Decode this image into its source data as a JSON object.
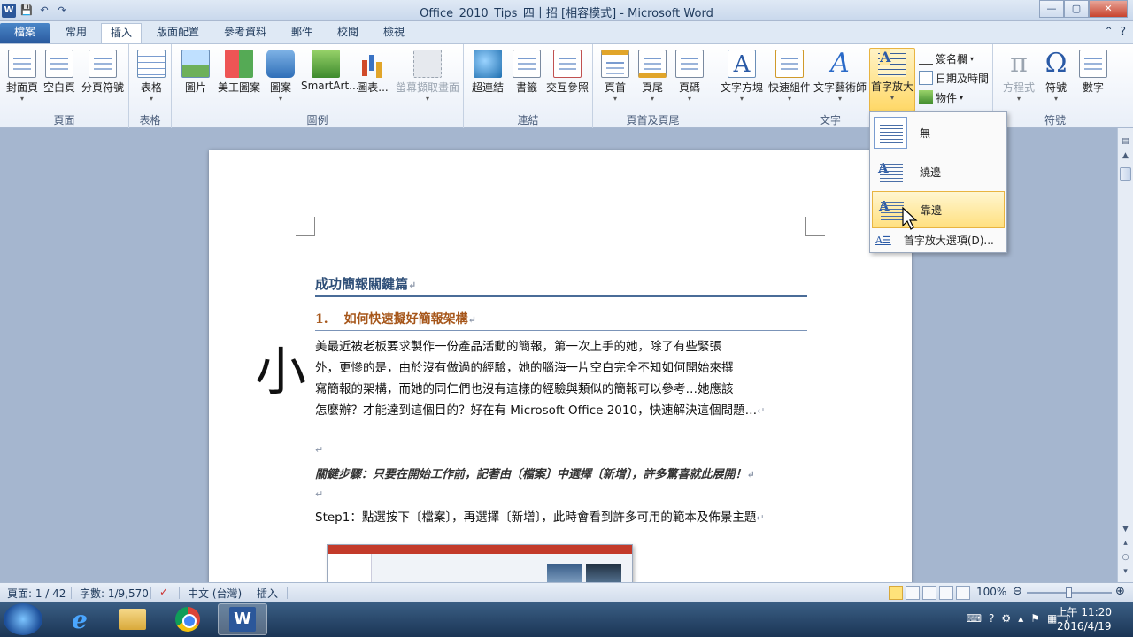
{
  "window": {
    "title": "Office_2010_Tips_四十招 [相容模式] - Microsoft Word",
    "qat": {
      "word_logo": "W",
      "save": "💾",
      "undo": "↶",
      "redo": "↷"
    },
    "buttons": {
      "minimize": "—",
      "maximize": "▢",
      "close": "✕"
    }
  },
  "tabs": {
    "file": "檔案",
    "items": [
      "常用",
      "插入",
      "版面配置",
      "參考資料",
      "郵件",
      "校閱",
      "檢視"
    ],
    "active": "插入",
    "help_icons": {
      "collapse": "⌃",
      "help": "?"
    }
  },
  "ribbon": {
    "groups": {
      "pages": {
        "label": "頁面",
        "buttons": [
          "封面頁",
          "空白頁",
          "分頁符號"
        ]
      },
      "tables": {
        "label": "表格",
        "buttons": [
          "表格"
        ]
      },
      "illustrations": {
        "label": "圖例",
        "buttons": [
          "圖片",
          "美工圖案",
          "圖案",
          "SmartArt...",
          "圖表...",
          "螢幕擷取畫面"
        ]
      },
      "links": {
        "label": "連結",
        "buttons": [
          "超連結",
          "書籤",
          "交互參照"
        ]
      },
      "header_footer": {
        "label": "頁首及頁尾",
        "buttons": [
          "頁首",
          "頁尾",
          "頁碼"
        ]
      },
      "text": {
        "label": "文字",
        "buttons": [
          "文字方塊",
          "快速組件",
          "文字藝術師",
          "首字放大"
        ],
        "small": [
          "簽名欄",
          "日期及時間",
          "物件"
        ]
      },
      "symbols": {
        "label": "符號",
        "buttons": [
          "方程式",
          "符號",
          "數字"
        ]
      }
    }
  },
  "dropcap_menu": {
    "items": [
      {
        "label": "無",
        "letter": ""
      },
      {
        "label": "繞邊",
        "letter": "A"
      },
      {
        "label": "靠邊",
        "letter": "A"
      }
    ],
    "options_label": "首字放大選項(D)..."
  },
  "document": {
    "heading1": "成功簡報關鍵篇",
    "heading2_num": "1.",
    "heading2": "如何快速擬好簡報架構",
    "dropcap": "小",
    "para_lines": [
      "美最近被老板要求製作一份產品活動的簡報，第一次上手的她，除了有些緊張",
      "外，更慘的是，由於沒有做過的經驗，她的腦海一片空白完全不知如何開始來撰",
      "寫簡報的架構，而她的同仁們也沒有這樣的經驗與類似的簡報可以參考…她應該",
      "怎麼辦？才能達到這個目的？好在有 Microsoft Office 2010，快速解決這個問題…"
    ],
    "para_mark": "↵",
    "key_steps": "關鍵步驟：只要在開始工作前，記著由〔檔案〕中選擇〔新增〕，許多驚喜就此展開！",
    "step1": "Step1：點選按下〔檔案〕，再選擇〔新增〕，此時會看到許多可用的範本及佈景主題"
  },
  "statusbar": {
    "page": "頁面: 1 / 42",
    "words": "字數: 1/9,570",
    "language": "中文 (台灣)",
    "mode": "插入",
    "zoom": "100%",
    "zoom_minus": "⊖",
    "zoom_plus": "⊕"
  },
  "taskbar": {
    "time": "上午 11:20",
    "date": "2016/4/19"
  }
}
